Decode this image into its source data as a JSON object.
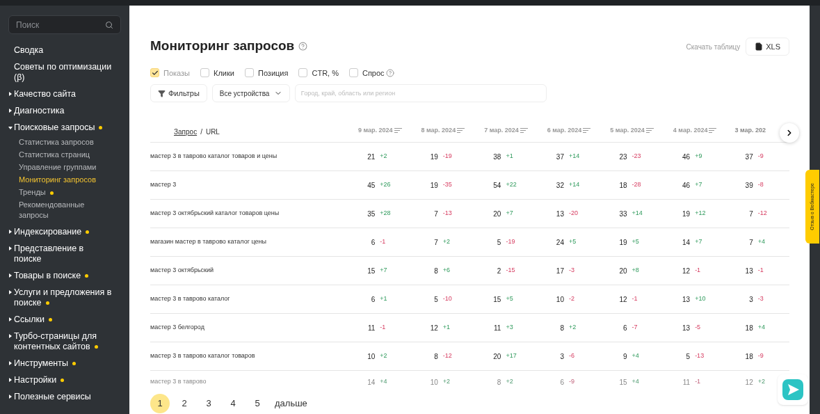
{
  "sidebar": {
    "search": {
      "placeholder": "Поиск"
    },
    "items": [
      {
        "label": "Сводка",
        "kind": "plain",
        "dot": false
      },
      {
        "label": "Советы по оптимизации (β)",
        "kind": "plain",
        "dot": false
      },
      {
        "label": "Качество сайта",
        "kind": "group",
        "expanded": false,
        "dot": false
      },
      {
        "label": "Диагностика",
        "kind": "group",
        "expanded": false,
        "dot": false
      },
      {
        "label": "Поисковые запросы",
        "kind": "group",
        "expanded": true,
        "dot": true,
        "children": [
          {
            "label": "Статистика запросов",
            "selected": false,
            "dot": false
          },
          {
            "label": "Статистика страниц",
            "selected": false,
            "dot": false
          },
          {
            "label": "Управление группами",
            "selected": false,
            "dot": false
          },
          {
            "label": "Мониторинг запросов",
            "selected": true,
            "dot": false
          },
          {
            "label": "Тренды",
            "selected": false,
            "dot": true
          },
          {
            "label": "Рекомендованные запросы",
            "selected": false,
            "dot": false
          }
        ]
      },
      {
        "label": "Индексирование",
        "kind": "group",
        "expanded": false,
        "dot": true
      },
      {
        "label": "Представление в поиске",
        "kind": "group",
        "expanded": false,
        "dot": false
      },
      {
        "label": "Товары в поиске",
        "kind": "group",
        "expanded": false,
        "dot": true
      },
      {
        "label": "Услуги и предложения в поиске",
        "kind": "group",
        "expanded": false,
        "dot": true
      },
      {
        "label": "Ссылки",
        "kind": "group",
        "expanded": false,
        "dot": true
      },
      {
        "label": "Турбо-страницы для контентных сайтов",
        "kind": "group",
        "expanded": false,
        "dot": true
      },
      {
        "label": "Инструменты",
        "kind": "group",
        "expanded": false,
        "dot": true
      },
      {
        "label": "Настройки",
        "kind": "group",
        "expanded": false,
        "dot": true
      },
      {
        "label": "Полезные сервисы",
        "kind": "group",
        "expanded": false,
        "dot": false
      }
    ]
  },
  "page": {
    "title": "Мониторинг запросов",
    "download_label": "Скачать таблицу",
    "download_button": "XLS"
  },
  "metrics": [
    {
      "label": "Показы",
      "checked": true,
      "help": false
    },
    {
      "label": "Клики",
      "checked": false,
      "help": false
    },
    {
      "label": "Позиция",
      "checked": false,
      "help": false
    },
    {
      "label": "CTR, %",
      "checked": false,
      "help": false
    },
    {
      "label": "Спрос",
      "checked": false,
      "help": true
    }
  ],
  "filters": {
    "button": "Фильтры",
    "device": "Все устройства",
    "region_placeholder": "Город, край, область или регион"
  },
  "table": {
    "query_header": "Запрос",
    "separator": "/",
    "url_header": "URL",
    "columns": [
      "9 мар. 2024",
      "8 мар. 2024",
      "7 мар. 2024",
      "6 мар. 2024",
      "5 мар. 2024",
      "4 мар. 2024",
      "3 мар. 202"
    ],
    "rows": [
      {
        "query": "мастер 3 в таврово каталог товаров и цены",
        "faded": false,
        "cells": [
          [
            "21",
            "+2"
          ],
          [
            "19",
            "-19"
          ],
          [
            "38",
            "+1"
          ],
          [
            "37",
            "+14"
          ],
          [
            "23",
            "-23"
          ],
          [
            "46",
            "+9"
          ],
          [
            "37",
            "-9"
          ]
        ]
      },
      {
        "query": "мастер 3",
        "faded": false,
        "cells": [
          [
            "45",
            "+26"
          ],
          [
            "19",
            "-35"
          ],
          [
            "54",
            "+22"
          ],
          [
            "32",
            "+14"
          ],
          [
            "18",
            "-28"
          ],
          [
            "46",
            "+7"
          ],
          [
            "39",
            "-8"
          ]
        ]
      },
      {
        "query": "мастер 3 октябрьский каталог товаров цены",
        "faded": false,
        "cells": [
          [
            "35",
            "+28"
          ],
          [
            "7",
            "-13"
          ],
          [
            "20",
            "+7"
          ],
          [
            "13",
            "-20"
          ],
          [
            "33",
            "+14"
          ],
          [
            "19",
            "+12"
          ],
          [
            "7",
            "-12"
          ]
        ]
      },
      {
        "query": "магазин мастер в таврово каталог цены",
        "faded": false,
        "cells": [
          [
            "6",
            "-1"
          ],
          [
            "7",
            "+2"
          ],
          [
            "5",
            "-19"
          ],
          [
            "24",
            "+5"
          ],
          [
            "19",
            "+5"
          ],
          [
            "14",
            "+7"
          ],
          [
            "7",
            "+4"
          ]
        ]
      },
      {
        "query": "мастер 3 октябрьский",
        "faded": false,
        "cells": [
          [
            "15",
            "+7"
          ],
          [
            "8",
            "+6"
          ],
          [
            "2",
            "-15"
          ],
          [
            "17",
            "-3"
          ],
          [
            "20",
            "+8"
          ],
          [
            "12",
            "-1"
          ],
          [
            "13",
            "-1"
          ]
        ]
      },
      {
        "query": "мастер 3 в таврово каталог",
        "faded": false,
        "cells": [
          [
            "6",
            "+1"
          ],
          [
            "5",
            "-10"
          ],
          [
            "15",
            "+5"
          ],
          [
            "10",
            "-2"
          ],
          [
            "12",
            "-1"
          ],
          [
            "13",
            "+10"
          ],
          [
            "3",
            "-3"
          ]
        ]
      },
      {
        "query": "мастер 3 белгород",
        "faded": false,
        "cells": [
          [
            "11",
            "-1"
          ],
          [
            "12",
            "+1"
          ],
          [
            "11",
            "+3"
          ],
          [
            "8",
            "+2"
          ],
          [
            "6",
            "-7"
          ],
          [
            "13",
            "-5"
          ],
          [
            "18",
            "+4"
          ]
        ]
      },
      {
        "query": "мастер 3 в таврово каталог товаров",
        "faded": false,
        "cells": [
          [
            "10",
            "+2"
          ],
          [
            "8",
            "-12"
          ],
          [
            "20",
            "+17"
          ],
          [
            "3",
            "-6"
          ],
          [
            "9",
            "+4"
          ],
          [
            "5",
            "-13"
          ],
          [
            "18",
            "-9"
          ]
        ]
      },
      {
        "query": "мастер 3 в таврово",
        "faded": true,
        "cells": [
          [
            "14",
            "+4"
          ],
          [
            "10",
            "+2"
          ],
          [
            "8",
            "+2"
          ],
          [
            "6",
            "-9"
          ],
          [
            "15",
            "+4"
          ],
          [
            "11",
            "-1"
          ],
          [
            "12",
            "+2"
          ]
        ]
      }
    ]
  },
  "pagination": [
    {
      "label": "1",
      "selected": true
    },
    {
      "label": "2",
      "selected": false
    },
    {
      "label": "3",
      "selected": false
    },
    {
      "label": "4",
      "selected": false
    },
    {
      "label": "5",
      "selected": false
    },
    {
      "label": "дальше",
      "selected": false
    }
  ],
  "feedback_tab": "Отзыв о Вебмастере"
}
